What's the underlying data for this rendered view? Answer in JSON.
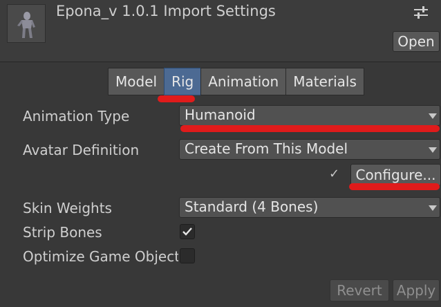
{
  "header": {
    "title": "Epona_v 1.0.1 Import Settings",
    "open_label": "Open",
    "settings_icon": "sliders-icon",
    "thumbnail": "model-thumbnail"
  },
  "tabs": [
    {
      "label": "Model",
      "active": false
    },
    {
      "label": "Rig",
      "active": true
    },
    {
      "label": "Animation",
      "active": false
    },
    {
      "label": "Materials",
      "active": false
    }
  ],
  "rig": {
    "animation_type": {
      "label": "Animation Type",
      "value": "Humanoid"
    },
    "avatar_definition": {
      "label": "Avatar Definition",
      "value": "Create From This Model"
    },
    "configure": {
      "check": "✓",
      "label": "Configure..."
    },
    "skin_weights": {
      "label": "Skin Weights",
      "value": "Standard (4 Bones)"
    },
    "strip_bones": {
      "label": "Strip Bones",
      "checked": true
    },
    "optimize_game_objects": {
      "label": "Optimize Game Objects",
      "checked": false
    }
  },
  "footer": {
    "revert_label": "Revert",
    "apply_label": "Apply"
  },
  "colors": {
    "annotation": "#e01b1b",
    "active_tab": "#4c6a93"
  }
}
